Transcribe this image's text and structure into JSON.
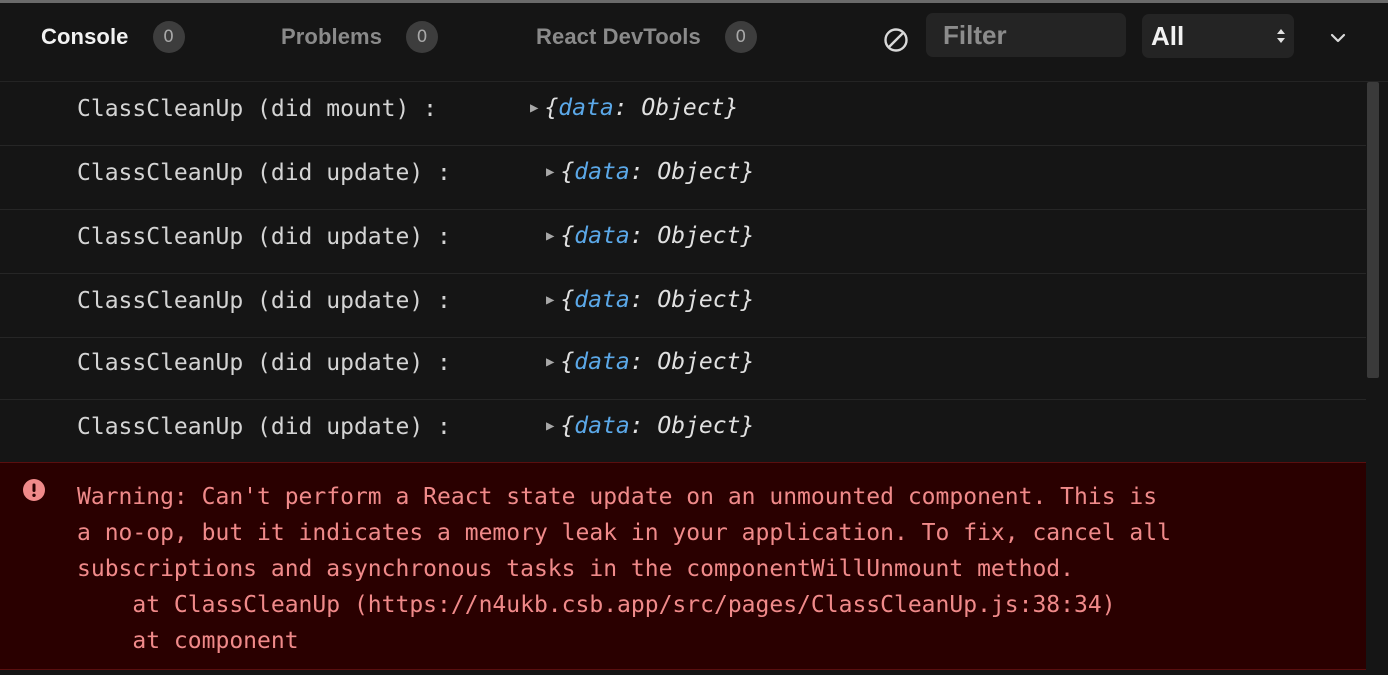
{
  "toolbar": {
    "tabs": [
      {
        "label": "Console",
        "count": "0"
      },
      {
        "label": "Problems",
        "count": "0"
      },
      {
        "label": "React DevTools",
        "count": "0"
      }
    ],
    "filter_placeholder": "Filter",
    "level_value": "All",
    "clear_icon": "clear-console-icon",
    "collapse_icon": "chevron-down-icon"
  },
  "logs": [
    {
      "message": "ClassCleanUp (did mount) :",
      "obj_open": "{",
      "obj_key": "data",
      "obj_sep": ": ",
      "obj_value": "Object",
      "obj_close": "}"
    },
    {
      "message": "ClassCleanUp (did update) :",
      "obj_open": "{",
      "obj_key": "data",
      "obj_sep": ": ",
      "obj_value": "Object",
      "obj_close": "}"
    },
    {
      "message": "ClassCleanUp (did update) :",
      "obj_open": "{",
      "obj_key": "data",
      "obj_sep": ": ",
      "obj_value": "Object",
      "obj_close": "}"
    },
    {
      "message": "ClassCleanUp (did update) :",
      "obj_open": "{",
      "obj_key": "data",
      "obj_sep": ": ",
      "obj_value": "Object",
      "obj_close": "}"
    },
    {
      "message": "ClassCleanUp (did update) :",
      "obj_open": "{",
      "obj_key": "data",
      "obj_sep": ": ",
      "obj_value": "Object",
      "obj_close": "}"
    },
    {
      "message": "ClassCleanUp (did update) :",
      "obj_open": "{",
      "obj_key": "data",
      "obj_sep": ": ",
      "obj_value": "Object",
      "obj_close": "}"
    }
  ],
  "warning": {
    "icon": "error-icon",
    "lines": [
      "Warning: Can't perform a React state update on an unmounted component. This is",
      "a no-op, but it indicates a memory leak in your application. To fix, cancel all",
      "subscriptions and asynchronous tasks in the componentWillUnmount method.",
      "    at ClassCleanUp (https://n4ukb.csb.app/src/pages/ClassCleanUp.js:38:34)",
      "    at component"
    ]
  },
  "colors": {
    "background": "#151515",
    "active_tab": "#f2f2f2",
    "inactive_tab": "#8a8a8a",
    "object_key": "#5ba8e8",
    "warning_bg": "#2a0000",
    "warning_text": "#f08a8a"
  }
}
